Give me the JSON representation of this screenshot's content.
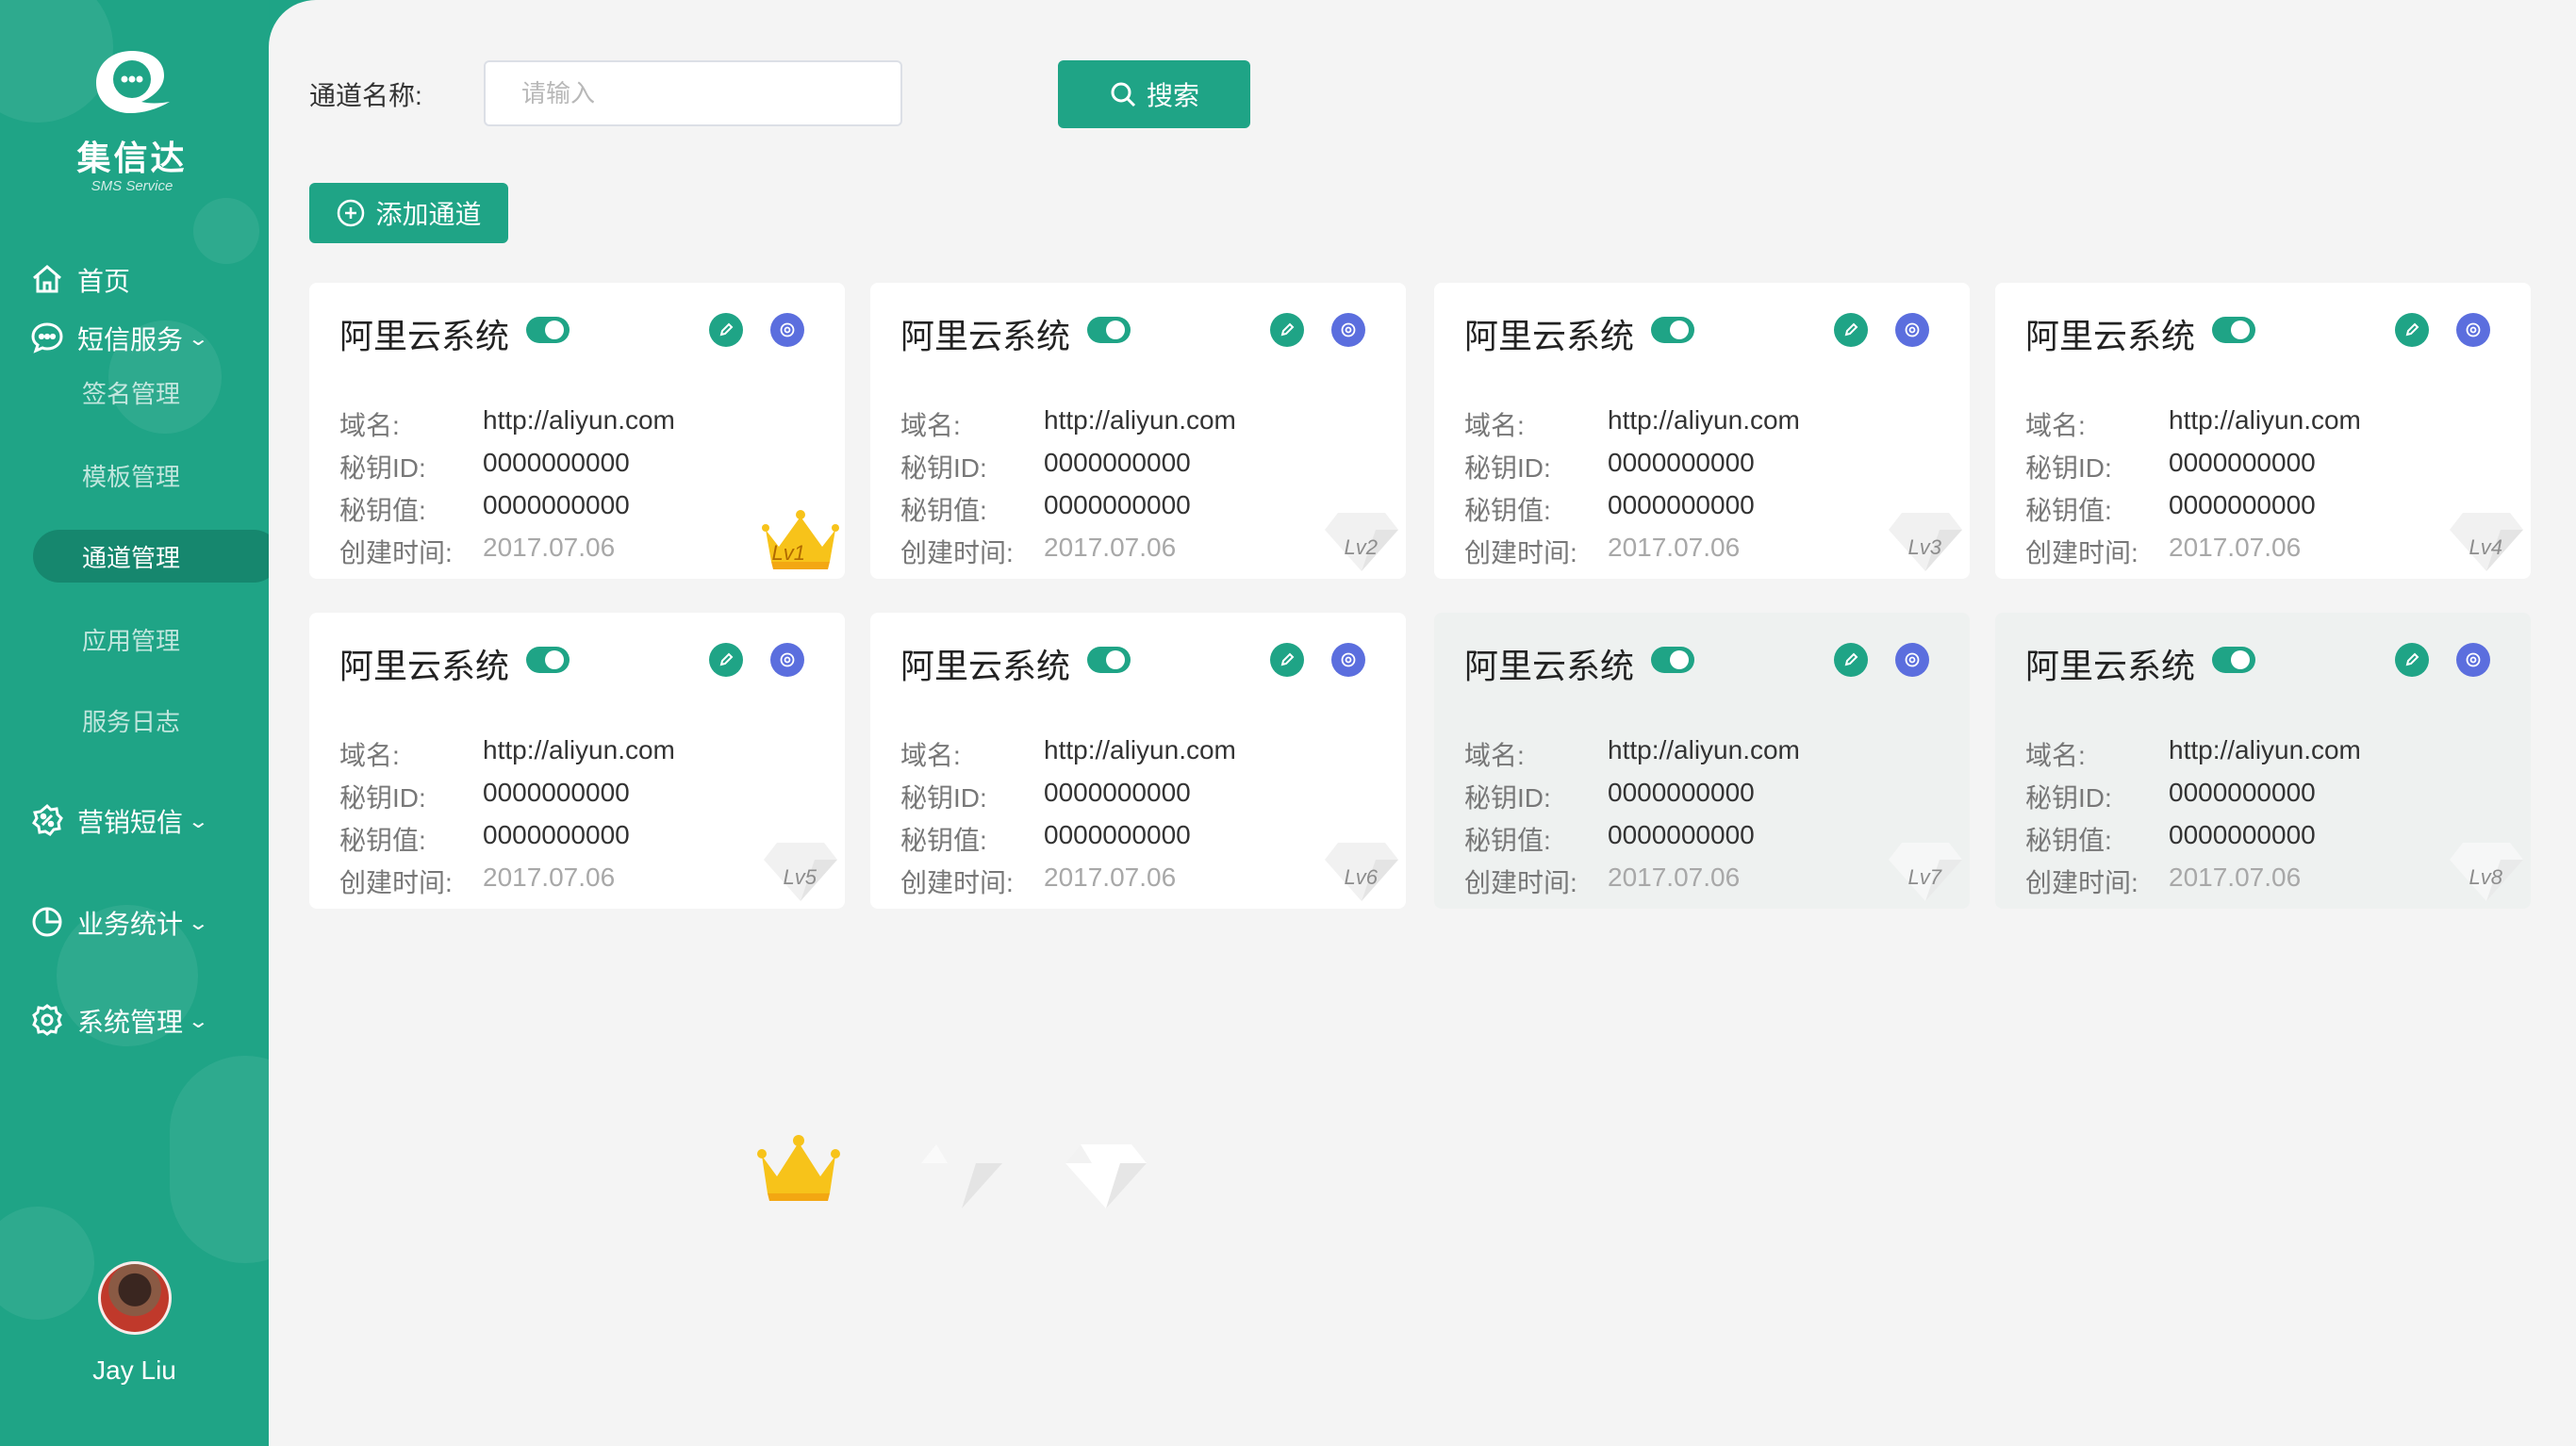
{
  "app": {
    "logo_title": "集信达",
    "logo_subtitle": "SMS Service"
  },
  "sidebar": {
    "items": [
      {
        "label": "首页",
        "icon": "home-icon"
      },
      {
        "label": "短信服务",
        "icon": "message-icon",
        "expandable": true
      },
      {
        "label": "营销短信",
        "icon": "marketing-icon",
        "expandable": true
      },
      {
        "label": "业务统计",
        "icon": "pie-chart-icon",
        "expandable": true
      },
      {
        "label": "系统管理",
        "icon": "settings-icon",
        "expandable": true
      }
    ],
    "sub_items": [
      {
        "label": "签名管理",
        "active": false
      },
      {
        "label": "模板管理",
        "active": false
      },
      {
        "label": "通道管理",
        "active": true
      },
      {
        "label": "应用管理",
        "active": false
      },
      {
        "label": "服务日志",
        "active": false
      }
    ],
    "chevron": "⌄",
    "user": {
      "name": "Jay Liu"
    }
  },
  "toolbar": {
    "search_label": "通道名称:",
    "search_placeholder": "请输入",
    "search_value": "",
    "search_button": "搜索",
    "add_button": "添加通道"
  },
  "field_labels": {
    "domain": "域名:",
    "key_id": "秘钥ID:",
    "key_value": "秘钥值:",
    "created": "创建时间:"
  },
  "cards": [
    {
      "title": "阿里云系统",
      "enabled": true,
      "domain": "http://aliyun.com",
      "key_id": "0000000000",
      "key_value": "0000000000",
      "created": "2017.07.06",
      "level": "Lv1",
      "level_icon": "crown-icon"
    },
    {
      "title": "阿里云系统",
      "enabled": true,
      "domain": "http://aliyun.com",
      "key_id": "0000000000",
      "key_value": "0000000000",
      "created": "2017.07.06",
      "level": "Lv2",
      "level_icon": "diamond-icon"
    },
    {
      "title": "阿里云系统",
      "enabled": true,
      "domain": "http://aliyun.com",
      "key_id": "0000000000",
      "key_value": "0000000000",
      "created": "2017.07.06",
      "level": "Lv3",
      "level_icon": "diamond-icon"
    },
    {
      "title": "阿里云系统",
      "enabled": true,
      "domain": "http://aliyun.com",
      "key_id": "0000000000",
      "key_value": "0000000000",
      "created": "2017.07.06",
      "level": "Lv4",
      "level_icon": "diamond-icon"
    },
    {
      "title": "阿里云系统",
      "enabled": true,
      "domain": "http://aliyun.com",
      "key_id": "0000000000",
      "key_value": "0000000000",
      "created": "2017.07.06",
      "level": "Lv5",
      "level_icon": "diamond-icon"
    },
    {
      "title": "阿里云系统",
      "enabled": true,
      "domain": "http://aliyun.com",
      "key_id": "0000000000",
      "key_value": "0000000000",
      "created": "2017.07.06",
      "level": "Lv6",
      "level_icon": "diamond-icon"
    },
    {
      "title": "阿里云系统",
      "enabled": true,
      "domain": "http://aliyun.com",
      "key_id": "0000000000",
      "key_value": "0000000000",
      "created": "2017.07.06",
      "level": "Lv7",
      "level_icon": "diamond-icon",
      "dimmed": true
    },
    {
      "title": "阿里云系统",
      "enabled": true,
      "domain": "http://aliyun.com",
      "key_id": "0000000000",
      "key_value": "0000000000",
      "created": "2017.07.06",
      "level": "Lv8",
      "level_icon": "diamond-icon",
      "dimmed": true
    }
  ],
  "colors": {
    "brand": "#1fa486",
    "brand_dark": "#16876e",
    "gear": "#5b6ede",
    "gold": "#f7c31a"
  }
}
